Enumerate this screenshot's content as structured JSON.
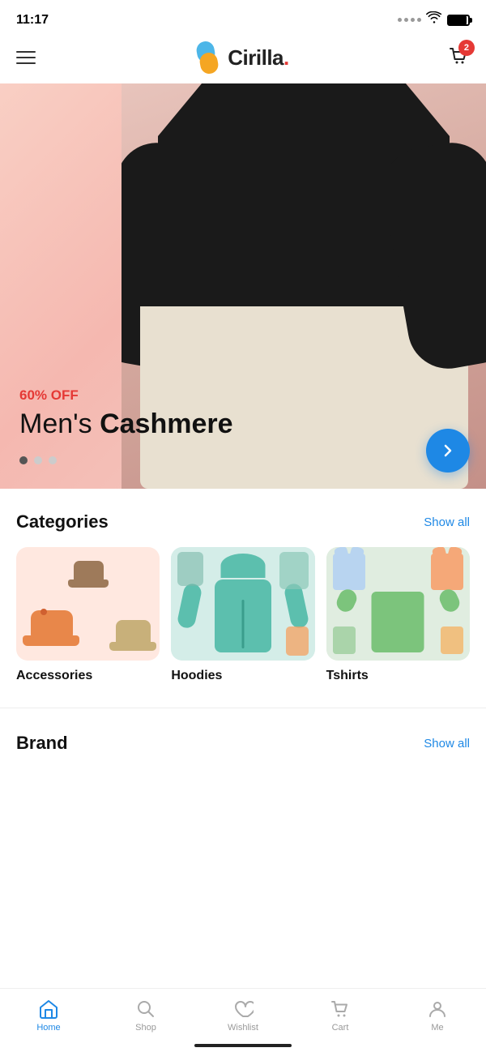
{
  "statusBar": {
    "time": "11:17"
  },
  "header": {
    "logoName": "Cirilla",
    "logoDot": ".",
    "cartBadge": "2"
  },
  "hero": {
    "discount": "60% OFF",
    "title": "Men's ",
    "titleBold": "Cashmere"
  },
  "categories": {
    "title": "Categories",
    "showAll": "Show all",
    "items": [
      {
        "label": "Accessories"
      },
      {
        "label": "Hoodies"
      },
      {
        "label": "Tshirts"
      }
    ]
  },
  "brand": {
    "title": "Brand",
    "showAll": "Show all"
  },
  "bottomNav": {
    "items": [
      {
        "label": "Home",
        "active": true
      },
      {
        "label": "Shop",
        "active": false
      },
      {
        "label": "Wishlist",
        "active": false
      },
      {
        "label": "Cart",
        "active": false
      },
      {
        "label": "Me",
        "active": false
      }
    ]
  }
}
